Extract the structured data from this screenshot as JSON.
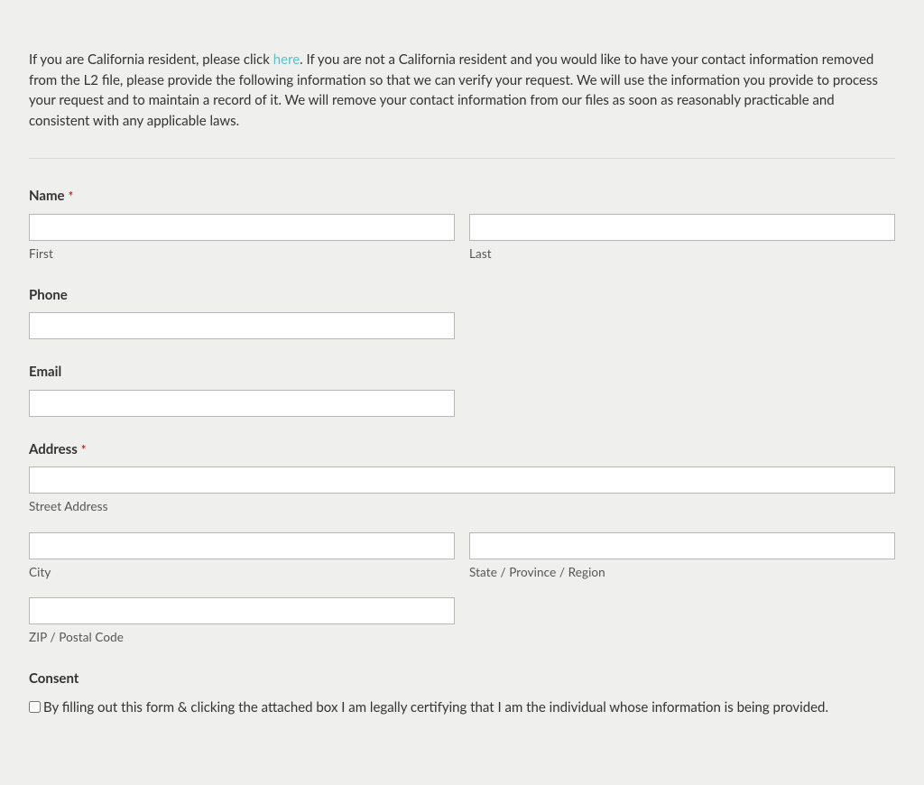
{
  "intro": {
    "before_link": "If you are California resident, please click ",
    "link_text": "here",
    "after_link": ". If you are not a California resident and you would like to have your contact information removed from the L2 file, please provide the following information so that we can verify your request. We will use the information you provide to process your request and to maintain a record of it. We will remove your contact information from our files as soon as reasonably practicable and consistent with any applicable laws."
  },
  "required_marker": "*",
  "fields": {
    "name": {
      "label": "Name",
      "required": true,
      "first_sub": "First",
      "last_sub": "Last",
      "first_value": "",
      "last_value": ""
    },
    "phone": {
      "label": "Phone",
      "value": ""
    },
    "email": {
      "label": "Email",
      "value": ""
    },
    "address": {
      "label": "Address",
      "required": true,
      "street_sub": "Street Address",
      "city_sub": "City",
      "region_sub": "State / Province / Region",
      "zip_sub": "ZIP / Postal Code",
      "street_value": "",
      "city_value": "",
      "region_value": "",
      "zip_value": ""
    },
    "consent": {
      "label": "Consent",
      "text": "By filling out this form & clicking the attached box I am legally certifying that I am the individual whose information is being provided.",
      "checked": false
    }
  }
}
